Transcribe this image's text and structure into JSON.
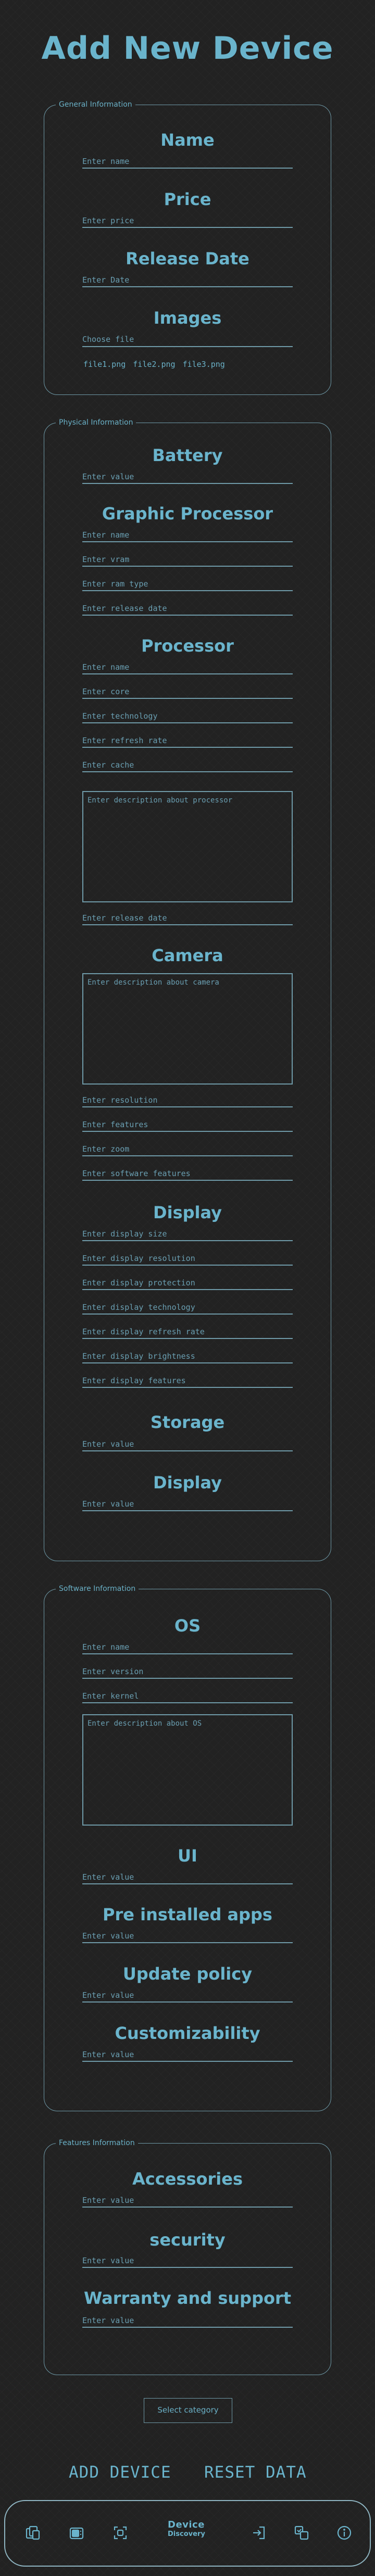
{
  "page_title": "Add New Device",
  "general": {
    "legend": "General Information",
    "name_heading": "Name",
    "name_placeholder": "Enter name",
    "price_heading": "Price",
    "price_placeholder": "Enter price",
    "release_heading": "Release Date",
    "release_placeholder": "Enter Date",
    "images_heading": "Images",
    "choose_file": "Choose file",
    "files": [
      "file1.png",
      "file2.png",
      "file3.png"
    ]
  },
  "physical": {
    "legend": "Physical Information",
    "battery_heading": "Battery",
    "battery_placeholder": "Enter value",
    "gpu_heading": "Graphic Processor",
    "gpu_fields": [
      "Enter name",
      "Enter vram",
      "Enter ram type",
      "Enter release date"
    ],
    "cpu_heading": "Processor",
    "cpu_fields": [
      "Enter name",
      "Enter core",
      "Enter technology",
      "Enter refresh rate",
      "Enter cache"
    ],
    "cpu_description": "Enter description about processor",
    "cpu_release": "Enter release date",
    "camera_heading": "Camera",
    "camera_description": "Enter description about camera",
    "camera_fields": [
      "Enter resolution",
      "Enter features",
      "Enter zoom",
      "Enter software features"
    ],
    "display_heading": "Display",
    "display_fields": [
      "Enter display size",
      "Enter display resolution",
      "Enter display protection",
      "Enter display technology",
      "Enter display refresh rate",
      "Enter display brightness",
      "Enter display features"
    ],
    "storage_heading": "Storage",
    "storage_placeholder": "Enter value",
    "display2_heading": "Display",
    "display2_placeholder": "Enter value"
  },
  "software": {
    "legend": "Software Information",
    "os_heading": "OS",
    "os_fields": [
      "Enter name",
      "Enter version",
      "Enter kernel"
    ],
    "os_description": "Enter description about OS",
    "ui_heading": "UI",
    "ui_placeholder": "Enter value",
    "apps_heading": "Pre installed apps",
    "apps_placeholder": "Enter value",
    "update_heading": "Update policy",
    "update_placeholder": "Enter value",
    "custom_heading": "Customizability",
    "custom_placeholder": "Enter value"
  },
  "features": {
    "legend": "Features Information",
    "accessories_heading": "Accessories",
    "accessories_placeholder": "Enter value",
    "security_heading": "security",
    "security_placeholder": "Enter value",
    "warranty_heading": "Warranty and support",
    "warranty_placeholder": "Enter value"
  },
  "select_category": "Select category",
  "actions": {
    "add_device": "ADD DEVICE",
    "reset_data": "RESET DATA"
  },
  "nav": {
    "brand_line1": "Device",
    "brand_line2": "Discovery",
    "icons": [
      "devices-icon",
      "phone-stack-icon",
      "scan-icon",
      "login-icon",
      "compare-icon",
      "info-icon"
    ]
  },
  "colors": {
    "accent": "#6ab4cc",
    "border": "#6f9aa8",
    "background": "#222222"
  }
}
